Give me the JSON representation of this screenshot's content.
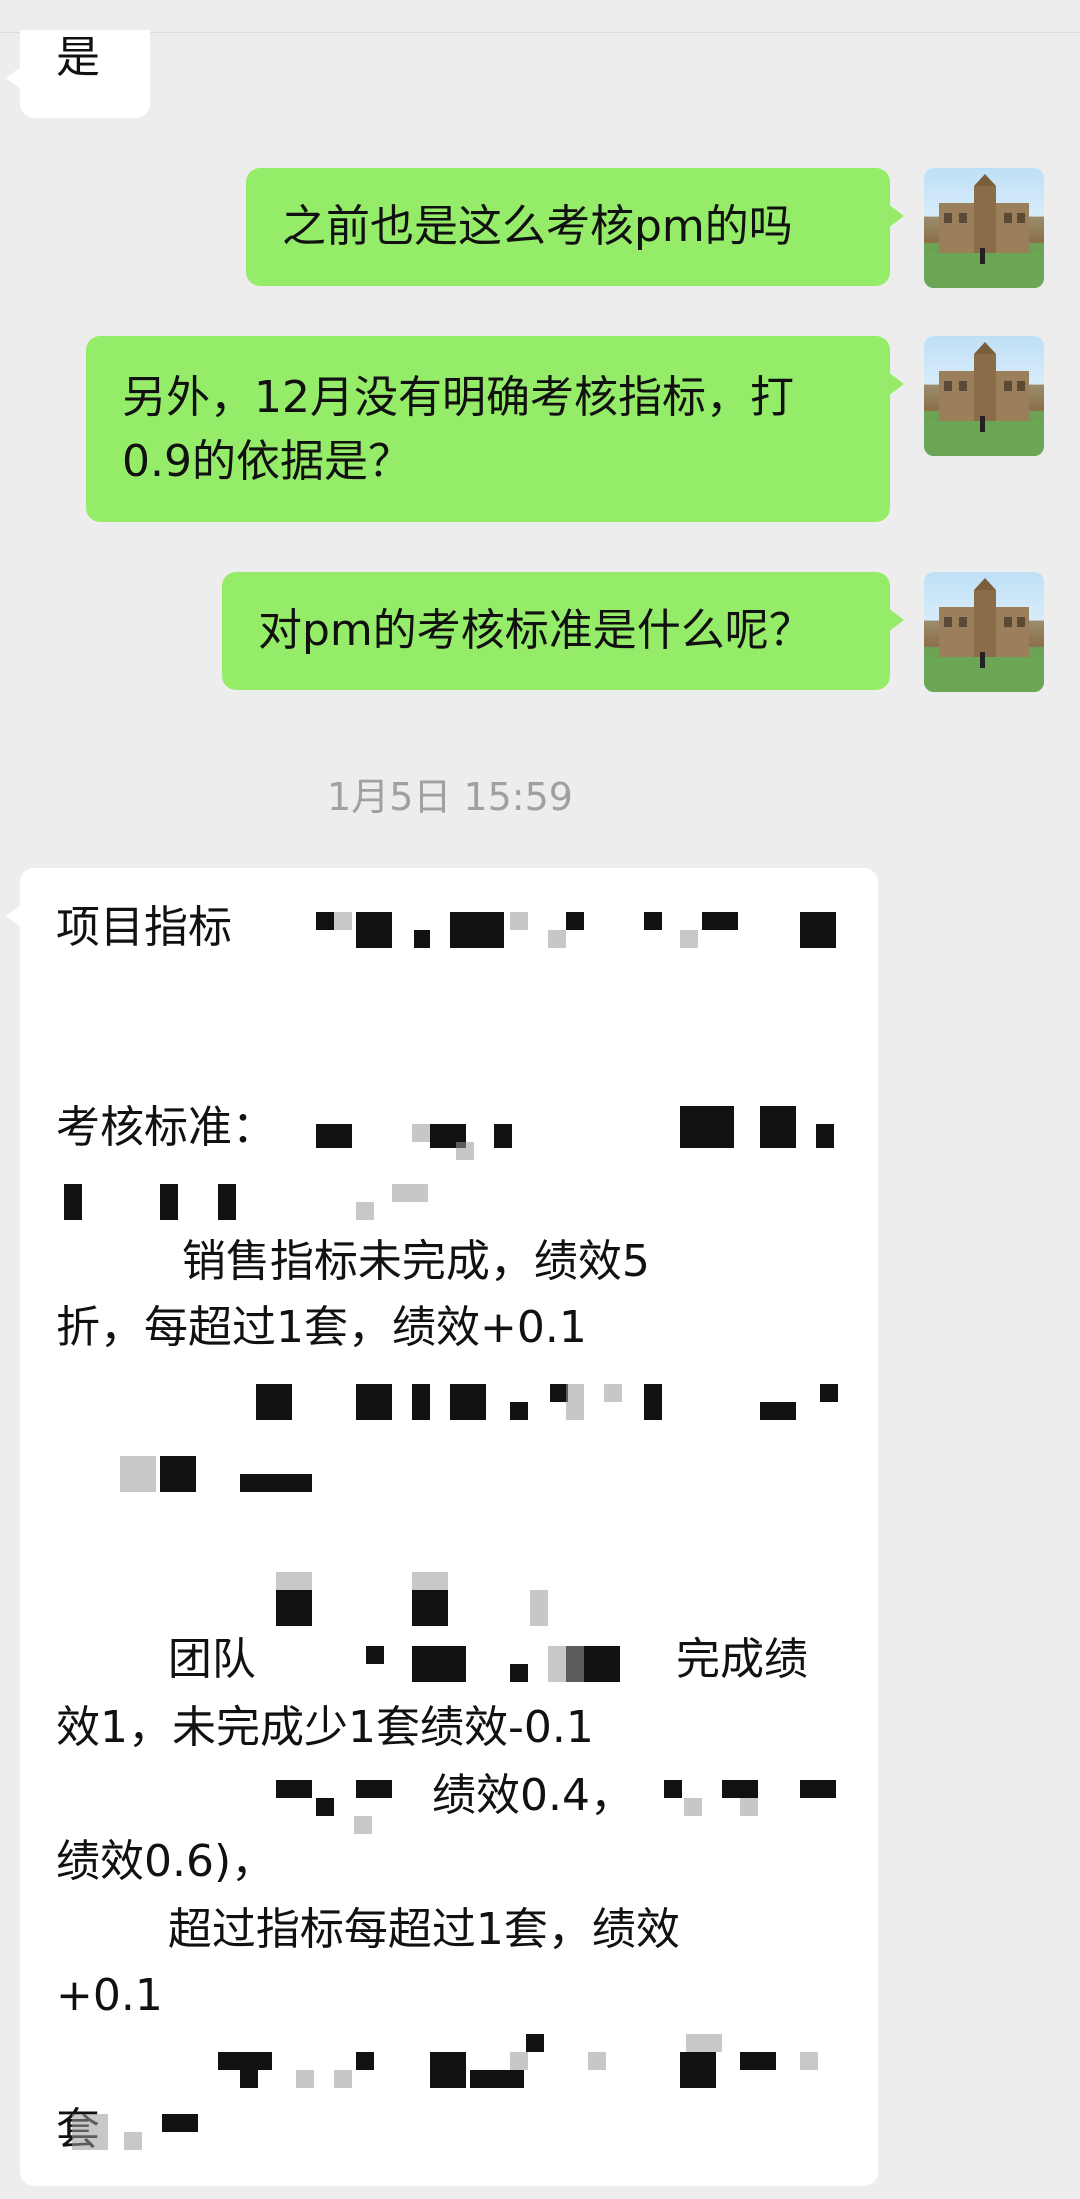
{
  "messages": [
    {
      "side": "left",
      "text": "是"
    },
    {
      "side": "right",
      "text": "之前也是这么考核pm的吗"
    },
    {
      "side": "right",
      "lines": [
        "另外，12月没有明确考核指标，打",
        "0.9的依据是？"
      ]
    },
    {
      "side": "right",
      "text": "对pm的考核标准是什么呢？"
    }
  ],
  "timestamp": "1月5日 15:59",
  "long_message": {
    "lines": [
      "项目指标",
      "考核标准：",
      "         销售指标未完成，绩效5",
      "折，每超过1套，绩效+0.1",
      "        团队",
      "完成绩",
      "效1，未完成少1套绩效-0.1",
      "绩效0.4，",
      "绩效0.6)，",
      "        超过指标每超过1套，绩效",
      "+0.1",
      "套"
    ]
  },
  "avatar_icon": "user-avatar-building-photo",
  "colors": {
    "background": "#ededed",
    "outgoing": "#95ec69",
    "incoming": "#ffffff",
    "timestamp": "#a0a0a0"
  }
}
